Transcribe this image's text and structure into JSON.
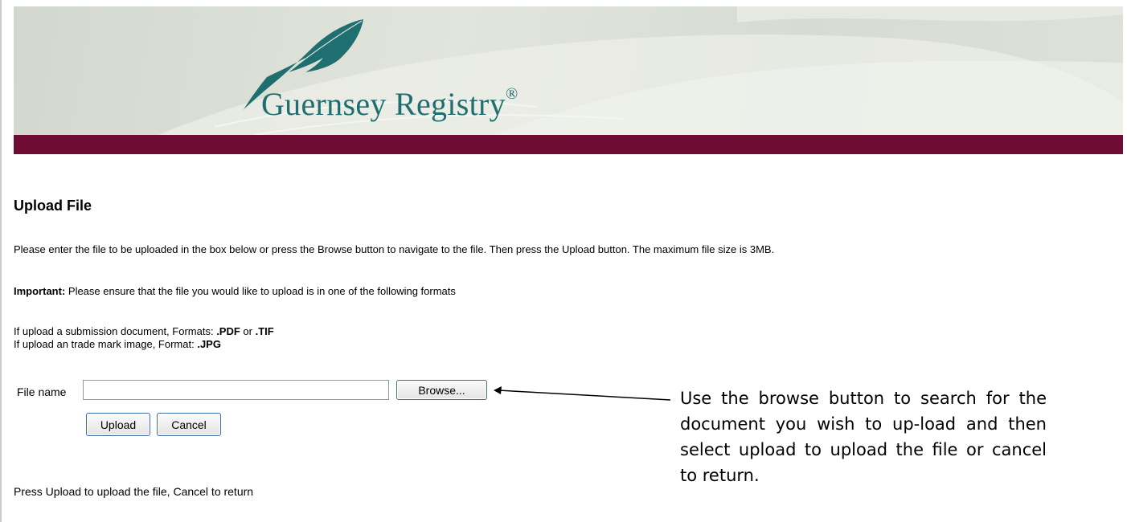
{
  "header": {
    "brand_name": "Guernsey Registry",
    "registered_mark": "®",
    "colors": {
      "brand_teal": "#1f6f70",
      "stripe": "#6f0c33",
      "banner_bg": "#d9ddd4"
    },
    "logo_icon": "quill-feather-icon"
  },
  "page": {
    "title": "Upload File",
    "instructions": "Please enter the file to be uploaded in the box below or press the Browse button to navigate to the file. Then press the Upload button. The maximum file size is 3MB.",
    "important_label": "Important:",
    "important_text": " Please ensure that the file you would like to upload is in one of the following formats",
    "formats": [
      {
        "prefix": "If upload a submission document, Formats: ",
        "code1": ".PDF",
        "joiner": " or ",
        "code2": ".TIF"
      },
      {
        "prefix": "If upload an trade mark image, Format: ",
        "code1": ".JPG"
      }
    ]
  },
  "form": {
    "file_label": "File name",
    "file_value": "",
    "browse_label": "Browse...",
    "upload_label": "Upload",
    "cancel_label": "Cancel"
  },
  "footer": {
    "text": "Press Upload to upload the file, Cancel to return"
  },
  "callout": {
    "text": "Use the browse button to search for the document you wish to up-load and then select upload to upload the file or cancel to return."
  }
}
